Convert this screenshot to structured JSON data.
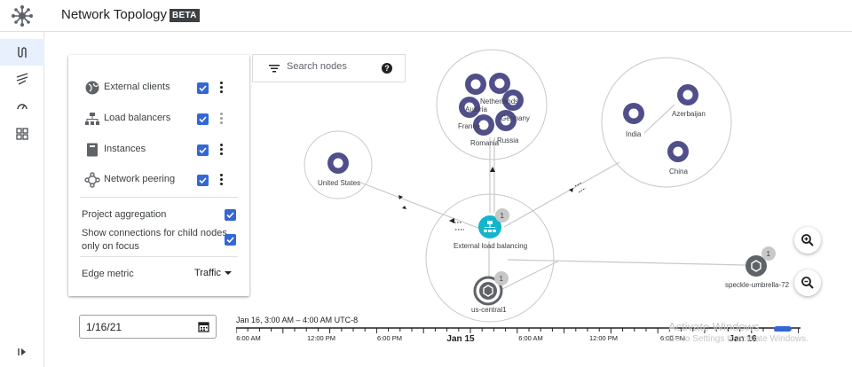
{
  "header": {
    "title": "Network Topology",
    "badge": "BETA"
  },
  "layers": {
    "items": [
      {
        "label": "External clients",
        "icon": "globe-icon",
        "checked": true
      },
      {
        "label": "Load balancers",
        "icon": "load-balancer-icon",
        "checked": true
      },
      {
        "label": "Instances",
        "icon": "instance-icon",
        "checked": true
      },
      {
        "label": "Network peering",
        "icon": "network-peering-icon",
        "checked": true
      }
    ],
    "project_aggregation_label": "Project aggregation",
    "show_connections_line1": "Show connections for child nodes",
    "show_connections_line2": "only on focus",
    "edge_metric_label": "Edge metric",
    "edge_metric_value": "Traffic"
  },
  "search": {
    "placeholder": "Search nodes",
    "help": "?"
  },
  "date": {
    "value": "1/16/21"
  },
  "timeline": {
    "range": "Jan 16, 3:00 AM – 4:00 AM UTC-8",
    "ticks": [
      "6:00 AM",
      "12:00 PM",
      "6:00 PM",
      "Jan 15",
      "6:00 AM",
      "12:00 PM",
      "6:00 PM",
      "Jan 16"
    ]
  },
  "graph": {
    "nodes": {
      "europe": [
        "Netherlands",
        "Austria",
        "Germany",
        "France",
        "Romania",
        "Russia"
      ],
      "asia": [
        "Azerbaijan",
        "India",
        "China"
      ],
      "us": "United States",
      "load_balancing": "External load balancing",
      "region": "us-central1",
      "peer": "speckle-umbrella-72",
      "badge_count": "1"
    }
  },
  "watermark": {
    "line1": "Activate Windows",
    "line2": "Go to Settings to activate Windows."
  },
  "colors": {
    "node": "#514f8a",
    "accent": "#3367d6",
    "lb": "#12b5cb"
  }
}
